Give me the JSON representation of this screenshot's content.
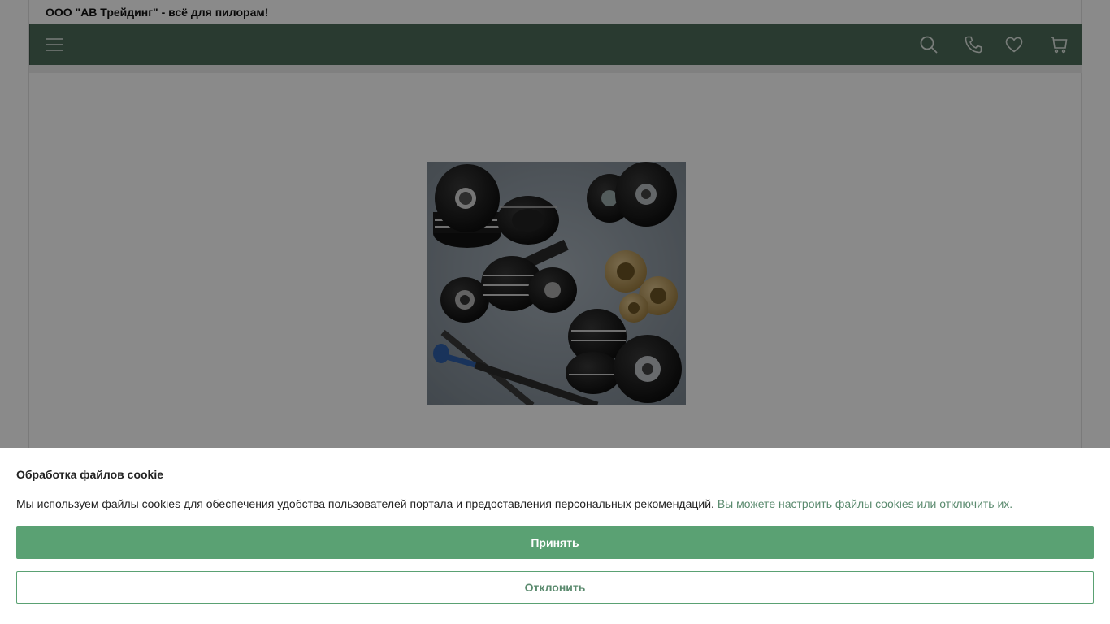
{
  "header": {
    "tagline": "ООО \"АВ Трейдинг\" - всё для пилорам!"
  },
  "navbar": {
    "background": "#4d6b5a",
    "icons": [
      "menu-icon",
      "search-icon",
      "phone-icon",
      "heart-icon",
      "cart-icon"
    ]
  },
  "hero": {
    "image": "sawmill-spare-parts-photo"
  },
  "cookie_banner": {
    "title": "Обработка файлов cookie",
    "text": "Мы используем файлы cookies для обеспечения удобства пользователей портала и предоставления персональных рекомендаций.",
    "link_text": "Вы можете настроить файлы cookies или отключить их.",
    "accept_label": "Принять",
    "decline_label": "Отклонить",
    "accent_color": "#5aa173"
  }
}
